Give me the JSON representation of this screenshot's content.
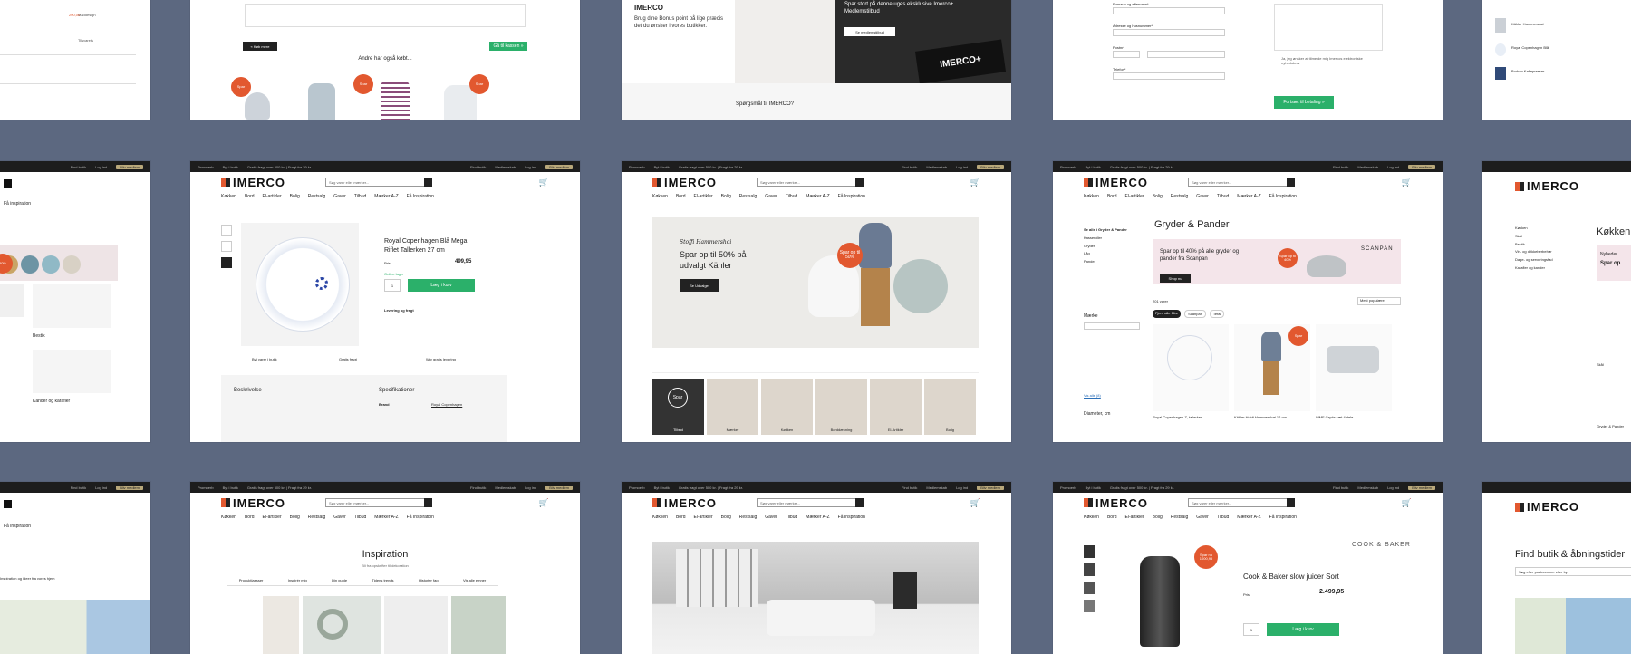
{
  "topbar": {
    "promo": "Promoerb",
    "buy": "Byt i butik",
    "shipping": "Gratis fragt over 500 kr. | Fragt fra 29 kr.",
    "find_store": "Find butik",
    "login": "Log ind",
    "member": "Bliv medlem",
    "customer": "Medlemskab"
  },
  "brand": "IMERCO",
  "search_placeholder": "Søg varer eller mærker...",
  "nav": [
    "Køkken",
    "Bord",
    "El-artikler",
    "Bolig",
    "Restsalg",
    "Gaver",
    "Tilbud",
    "Mærker A-Z",
    "Få Inspiration"
  ],
  "row1": {
    "card2": {
      "also_bought": "Andre har også købt...",
      "back": "« Køb mere",
      "to_cart": "Gå til kassen »"
    },
    "card3": {
      "bonus": "Brug dine Bonus point på lige præcis det du ønsker i vores butikker.",
      "offer": "Spar stort på denne uges eksklusive Imerco+ Medlemstilbud",
      "offer_btn": "Se medlemstilbud",
      "question": "Spørgsmål til IMERCO?",
      "card_logo": "IMERCO+"
    },
    "card4": {
      "label1": "Fornavn og efternavn*",
      "label2": "Adresse og husnummer*",
      "label3": "Postnr*",
      "label4": "By*",
      "label5": "Telefon*",
      "consent": "Ja, jeg ønsker at tilmelde mig Imercos elektroniske nyhedsbrev",
      "continue": "Fortsæt til betaling »"
    },
    "card5": {
      "items": [
        "Kähler Hammershøi",
        "Royal Copenhagen Blå",
        "Bodum Kaffepresser"
      ]
    }
  },
  "row2": {
    "card1": {
      "inspiration": "Få inspiration",
      "c1": "Bestik",
      "c2": "Kander og karafler"
    },
    "product": {
      "title": "Royal Copenhagen Blå Mega Riflet Tallerken 27 cm",
      "price_label": "Pris",
      "price": "499,95",
      "stock": "Online lager",
      "add": "Læg i kurv",
      "delivery": "Levering og fragt",
      "desc_head": "Beskrivelse",
      "spec_head": "Specifikationer",
      "brand_label": "Brand",
      "brand_value": "Royal Copenhagen",
      "usp1": "Byt varer i butik",
      "usp2": "Gratis fragt",
      "usp3": "Wtv gratis levering"
    },
    "home": {
      "hero_script": "Stoffi Hammershoi",
      "hero_title": "Spar op til 50% på udvalgt Kähler",
      "hero_btn": "Se Udvalget",
      "badge": "Spar op til 50%",
      "cats": [
        "Tilbud",
        "Mærker",
        "Køkken",
        "Borddækning",
        "El-Artikler",
        "Bolig"
      ],
      "spar": "Spar"
    },
    "category": {
      "title": "Gryder & Pander",
      "banner": "Spar op til 40% på alle gryder og pander fra Scanpan",
      "banner_btn": "Shop nu",
      "badge": "Spar op til 40%",
      "brand": "SCANPAN",
      "count": "201 varer",
      "sort": "Mest populære",
      "filter_brand": "Mærke",
      "filter_size": "Diameter, cm",
      "chips": [
        "Fjern alle filtre",
        "Scanpan",
        "Tefal"
      ],
      "side": [
        "Se alle i Gryder & Pander",
        "Kasseroller",
        "Gryder",
        "Låg",
        "Pander"
      ],
      "products": [
        "Royal Copenhagen Z, tallerken",
        "Kähler Hvidt Hammershøi 12 cm",
        "WMF Gryde sæt 4 dele"
      ],
      "show_all": "Vis alle (8)"
    },
    "card5": {
      "title": "Køkken",
      "news": "Nyheder",
      "spar": "Spar op",
      "menu": [
        "Køkken",
        "Skål",
        "Bestik",
        "Vin- og drikkeberbehør",
        "Dage- og serveringsfad",
        "Karafler og kander"
      ],
      "c1": "Skål",
      "c2": "Gryder & Pander"
    }
  },
  "row3": {
    "card1": {
      "inspiration": "Få inspiration",
      "text": "Inspiration og ideer fra vores hjem"
    },
    "inspiration": {
      "title": "Inspiration",
      "sub": "Bli fra opskrifter til dekoration",
      "tabs": [
        "Produktlaesser",
        "Inspirér mig",
        "Din guide",
        "Tidens trends",
        "Historier fag",
        "Vis alle emner"
      ]
    },
    "juicer": {
      "title": "Cook & Baker slow juicer Sort",
      "price": "2.499,95",
      "add": "Læg i kurv",
      "brand": "COOK & BAKER",
      "badge": "Spar nu 1000,95",
      "price_label": "Pris"
    },
    "store": {
      "title": "Find butik & åbningstider",
      "search": "Søg efter postnummer eller by"
    }
  }
}
